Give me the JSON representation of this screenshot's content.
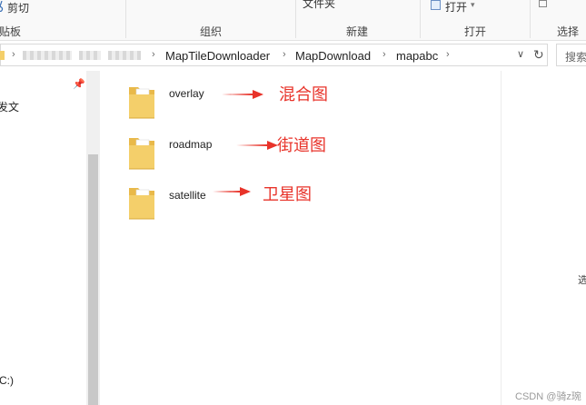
{
  "ribbon": {
    "cut_label": "剪切",
    "clipboard_partial": "贴板",
    "organize_group": "组织",
    "new_folder_partial": "文件夹",
    "new_group": "新建",
    "open_button": "打开",
    "open_group": "打开",
    "select_group": "选择"
  },
  "address": {
    "crumbs": [
      "MapTileDownloader",
      "MapDownload",
      "mapabc"
    ]
  },
  "search": {
    "placeholder": "搜索"
  },
  "nav": {
    "item_partial": "发文",
    "drive_partial": "C:)"
  },
  "files": [
    {
      "name": "overlay",
      "annotation": "混合图"
    },
    {
      "name": "roadmap",
      "annotation": "街道图"
    },
    {
      "name": "satellite",
      "annotation": "卫星图"
    }
  ],
  "preview": {
    "text_partial": "选"
  },
  "watermark": "CSDN @骑z琬",
  "colors": {
    "annotation_red": "#e8332a",
    "folder_yellow": "#f4cf6a",
    "ribbon_bg": "#f9f9f9"
  }
}
